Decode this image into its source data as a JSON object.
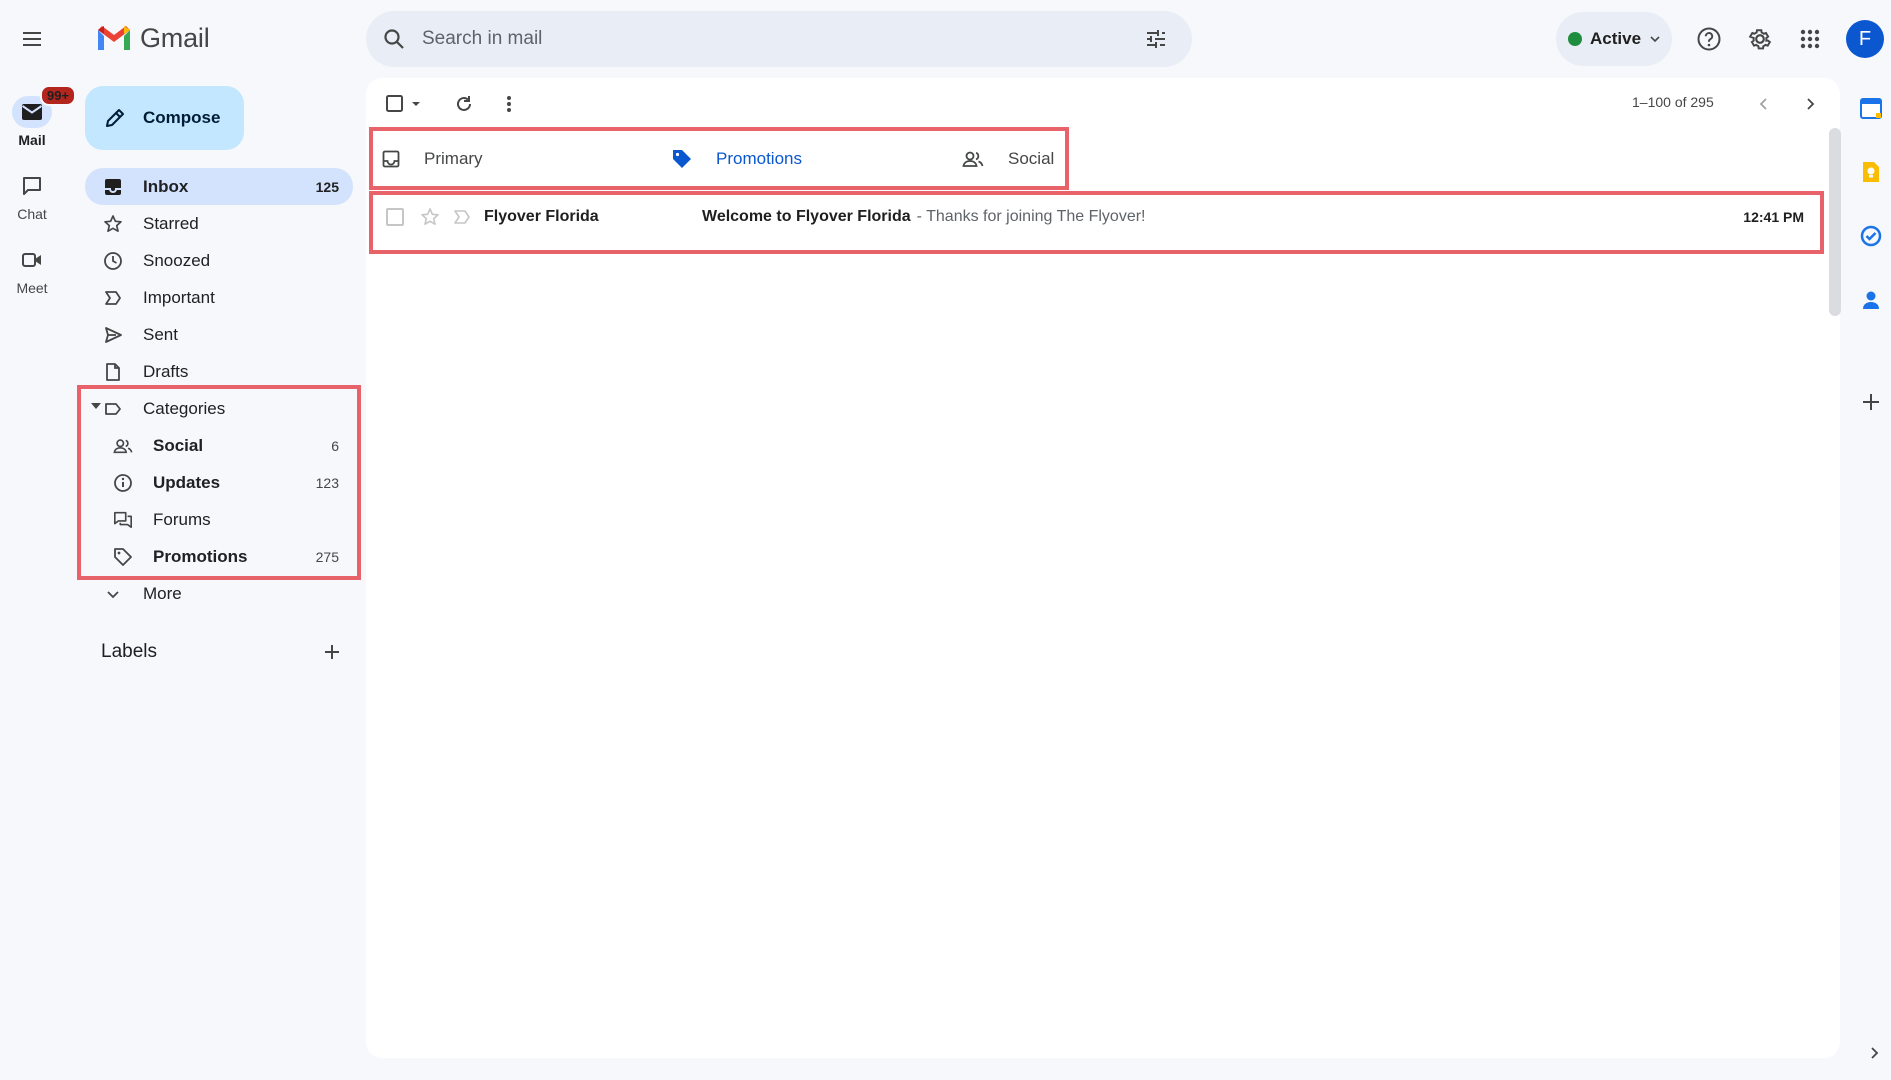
{
  "app": {
    "name": "Gmail"
  },
  "search": {
    "placeholder": "Search in mail"
  },
  "status": {
    "label": "Active",
    "color": "#1e8e3e"
  },
  "account": {
    "initial": "F"
  },
  "rail": [
    {
      "label": "Mail",
      "badge": "99+",
      "icon": "mail-icon"
    },
    {
      "label": "Chat",
      "icon": "chat-icon"
    },
    {
      "label": "Meet",
      "icon": "video-icon"
    }
  ],
  "compose": {
    "label": "Compose"
  },
  "nav": {
    "inbox": {
      "label": "Inbox",
      "count": "125"
    },
    "starred": {
      "label": "Starred"
    },
    "snoozed": {
      "label": "Snoozed"
    },
    "important": {
      "label": "Important"
    },
    "sent": {
      "label": "Sent"
    },
    "drafts": {
      "label": "Drafts"
    },
    "categories": {
      "label": "Categories"
    },
    "social": {
      "label": "Social",
      "count": "6"
    },
    "updates": {
      "label": "Updates",
      "count": "123"
    },
    "forums": {
      "label": "Forums"
    },
    "promotions": {
      "label": "Promotions",
      "count": "275"
    },
    "more": {
      "label": "More"
    }
  },
  "labels": {
    "heading": "Labels"
  },
  "toolbar": {
    "page_info": "1–100 of 295"
  },
  "tabs": [
    {
      "label": "Primary",
      "icon": "inbox-icon"
    },
    {
      "label": "Promotions",
      "icon": "tag-icon",
      "active": true
    },
    {
      "label": "Social",
      "icon": "people-icon"
    }
  ],
  "emails": [
    {
      "sender": "Flyover Florida",
      "subject": "Welcome to Flyover Florida",
      "snippet": "- Thanks for joining The Flyover!",
      "time": "12:41 PM"
    }
  ],
  "colors": {
    "accent": "#0b57d0",
    "compose_bg": "#c2e7ff",
    "selected_bg": "#d3e3fd",
    "highlight": "#e8626a"
  }
}
